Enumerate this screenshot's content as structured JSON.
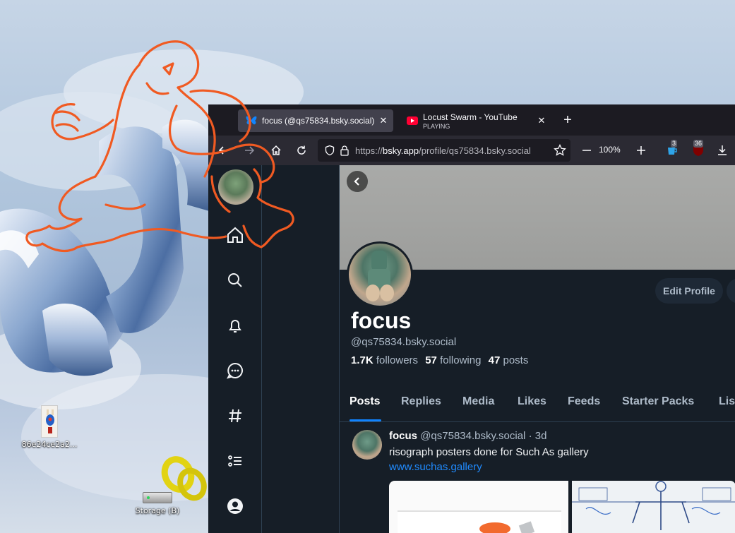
{
  "desktop": {
    "icons": [
      {
        "label": "86e24ce2a2..."
      },
      {
        "label": "Storage (B)"
      }
    ]
  },
  "browser": {
    "tabs": [
      {
        "title": "focus (@qs75834.bsky.social) —",
        "active": true
      },
      {
        "title": "Locust Swarm - YouTube",
        "subtitle": "PLAYING",
        "active": false
      }
    ],
    "new_tab": "+",
    "close_glyph": "✕",
    "url_scheme": "https://",
    "url_host": "bsky.app",
    "url_path": "/profile/qs75834.bsky.social",
    "zoom_level": "100%",
    "extension_badges": [
      "3",
      "36"
    ]
  },
  "profile": {
    "display_name": "focus",
    "handle": "@qs75834.bsky.social",
    "followers_count": "1.7K",
    "followers_label": "followers",
    "following_count": "57",
    "following_label": "following",
    "posts_count": "47",
    "posts_label": "posts",
    "edit_button": "Edit Profile",
    "tabs": [
      "Posts",
      "Replies",
      "Media",
      "Likes",
      "Feeds",
      "Starter Packs",
      "Lis"
    ]
  },
  "post": {
    "author": "focus",
    "handle": "@qs75834.bsky.social",
    "time": "· 3d",
    "text": "risograph posters done for Such As gallery",
    "link": "www.suchas.gallery"
  },
  "colors": {
    "accent": "#1083fe",
    "page_bg": "#161e27",
    "firefox_toolbar": "#2b2a33",
    "sticker_orange": "#f05a22"
  }
}
